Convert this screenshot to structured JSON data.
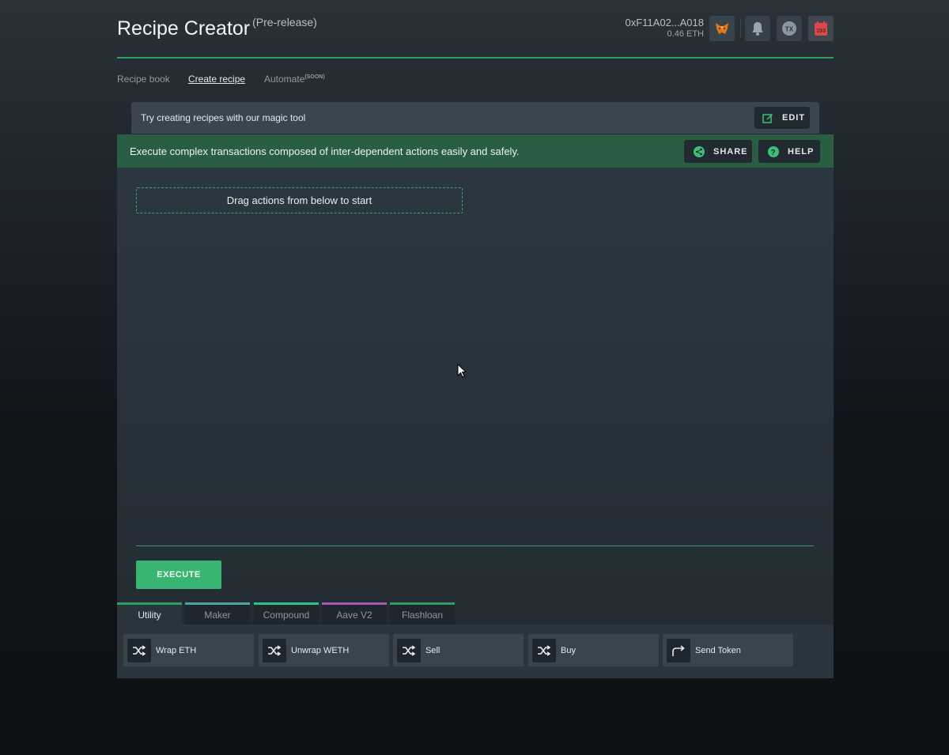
{
  "header": {
    "title": "Recipe Creator",
    "subtitle": "(Pre-release)",
    "wallet_address": "0xF11A02...A018",
    "wallet_balance": "0.46 ETH",
    "tx_badge": "TX",
    "calendar_badge": "193",
    "icons": [
      "metamask-fox-icon",
      "bell-icon",
      "tx-icon",
      "calendar-icon"
    ]
  },
  "nav": {
    "recipe_book": "Recipe book",
    "create_recipe": "Create recipe",
    "automate": "Automate",
    "automate_badge": "(SOON)"
  },
  "magic": {
    "text": "Try creating recipes with our magic tool",
    "edit_label": "EDIT"
  },
  "banner": {
    "text": "Execute complex transactions composed of inter-dependent actions easily and safely.",
    "share_label": "SHARE",
    "help_label": "HELP"
  },
  "workspace": {
    "dropzone_text": "Drag actions from below to start",
    "execute_label": "EXECUTE"
  },
  "tabs": [
    {
      "label": "Utility",
      "color": "#2f9e63",
      "active": true
    },
    {
      "label": "Maker",
      "color": "#4aa5a0",
      "active": false
    },
    {
      "label": "Compound",
      "color": "#2fbf8a",
      "active": false
    },
    {
      "label": "Aave V2",
      "color": "#a55bb5",
      "active": false
    },
    {
      "label": "Flashloan",
      "color": "#2f9e63",
      "active": false
    }
  ],
  "actions": [
    {
      "label": "Wrap ETH",
      "icon": "shuffle-icon"
    },
    {
      "label": "Unwrap WETH",
      "icon": "shuffle-icon"
    },
    {
      "label": "Sell",
      "icon": "shuffle-icon"
    },
    {
      "label": "Buy",
      "icon": "shuffle-icon"
    },
    {
      "label": "Send Token",
      "icon": "forward-arrow-icon"
    }
  ],
  "colors": {
    "accent": "#2f9e63",
    "execute": "#38b571",
    "banner": "#2a5e42"
  }
}
